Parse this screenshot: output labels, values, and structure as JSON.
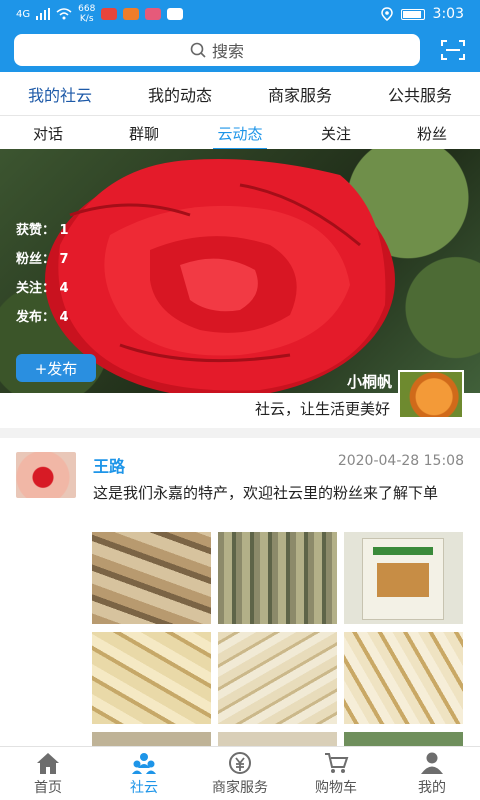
{
  "status_bar": {
    "network": "4G",
    "speed": "668\nK/s",
    "time": "3:03"
  },
  "header": {
    "search_placeholder": "搜索",
    "search_icon": "search-icon",
    "scan_icon": "scan-icon"
  },
  "tabs_primary": [
    {
      "label": "我的社云",
      "active": true
    },
    {
      "label": "我的动态",
      "active": false
    },
    {
      "label": "商家服务",
      "active": false
    },
    {
      "label": "公共服务",
      "active": false
    }
  ],
  "tabs_secondary": [
    {
      "label": "对话",
      "active": false
    },
    {
      "label": "群聊",
      "active": false
    },
    {
      "label": "云动态",
      "active": true
    },
    {
      "label": "关注",
      "active": false
    },
    {
      "label": "粉丝",
      "active": false
    }
  ],
  "profile": {
    "stats": [
      {
        "label": "获赞",
        "value": "1"
      },
      {
        "label": "粉丝",
        "value": "7"
      },
      {
        "label": "关注",
        "value": "4"
      },
      {
        "label": "发布",
        "value": "4"
      }
    ],
    "post_button": "+发布",
    "name": "小桐帆",
    "slogan": "社云，让生活更美好"
  },
  "post": {
    "author": "王路",
    "time": "2020-04-28 15:08",
    "text": "这是我们永嘉的特产，欢迎社云里的粉丝来了解下单"
  },
  "bottom_nav": [
    {
      "label": "首页",
      "icon": "home-icon",
      "active": false
    },
    {
      "label": "社云",
      "icon": "community-icon",
      "active": true
    },
    {
      "label": "商家服务",
      "icon": "merchant-icon",
      "active": false
    },
    {
      "label": "购物车",
      "icon": "cart-icon",
      "active": false
    },
    {
      "label": "我的",
      "icon": "profile-icon",
      "active": false
    }
  ],
  "colors": {
    "brand": "#1e95e8",
    "active_tab": "#1e5aa8"
  }
}
